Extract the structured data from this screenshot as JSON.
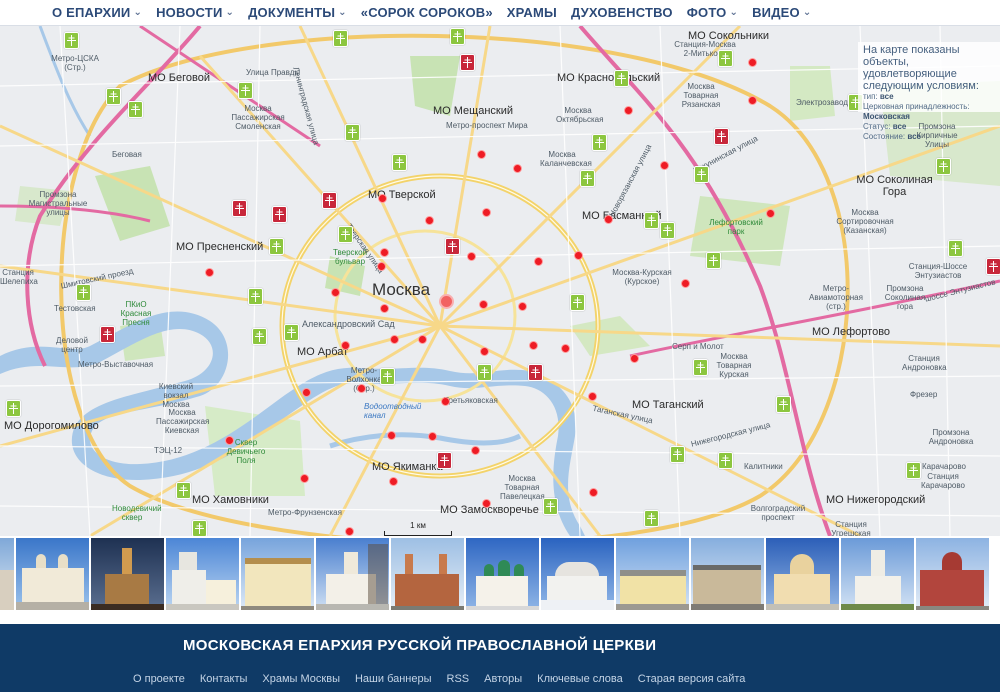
{
  "nav": [
    {
      "label": "О ЕПАРХИИ",
      "dropdown": true
    },
    {
      "label": "НОВОСТИ",
      "dropdown": true
    },
    {
      "label": "ДОКУМЕНТЫ",
      "dropdown": true
    },
    {
      "label": "«СОРОК СОРОКОВ»",
      "dropdown": false
    },
    {
      "label": "ХРАМЫ",
      "dropdown": false
    },
    {
      "label": "ДУХОВЕНСТВО",
      "dropdown": false
    },
    {
      "label": "ФОТО",
      "dropdown": true
    },
    {
      "label": "ВИДЕО",
      "dropdown": true
    }
  ],
  "map": {
    "city_label": "Москва",
    "districts": [
      "МО Беговой",
      "МО Красносельский",
      "МО Сокольники",
      "МО Мещанский",
      "МО Тверской",
      "МО Басманный",
      "МО Соколиная Гора",
      "МО Пресненский",
      "МО Арбат",
      "МО Лефортово",
      "МО Таганский",
      "МО Дорогомилово",
      "МО Якиманка",
      "МО Замоскворечье",
      "МО Хамовники",
      "МО Нижегородский"
    ],
    "places": [
      "Метро-ЦСКА (Стр.)",
      "Москва Пассажирская Смоленская",
      "Беговая",
      "Промзона Магистральные улицы",
      "Станция Шелепиха",
      "Тестовская",
      "ПКиО Красная Пресня",
      "Деловой центр",
      "Метро-Выставочная",
      "Киевский вокзал Москва",
      "Москва Пассажирская Киевская",
      "ТЭЦ-12",
      "Сквер Девичьего Поля",
      "Новодевичий сквер",
      "Метро-Фрунзенская",
      "Метро-Волхонка (Стр.)",
      "Александровский Сад",
      "Тверской бульвар",
      "Метро-проспект Мира",
      "Москва Октябрьская",
      "Москва Каланчевская",
      "Станция-Москва 2-Митьково",
      "Москва Товарная Рязанская",
      "Лефортовский парк",
      "Москва Сортировочная (Казанская)",
      "Москва-Курская (Курское)",
      "Метро-Авиамоторная (стр.)",
      "Промзона Соколиная гора",
      "Серп и Молот",
      "Москва Товарная Курская",
      "Третьяковская",
      "Водоотводный канал",
      "Москва Товарная Павелецкая",
      "Волгоградский проспект",
      "Калитники",
      "Станция Андроновка",
      "Фрезер",
      "Промзона Андроновка",
      "Карачарово",
      "Станция Карачарово",
      "Промзона Кирпичные Улицы",
      "Электрозаводская",
      "Станция-Шоссе Энтузиастов",
      "Станция Угрешская"
    ],
    "streets": [
      "Ленинградская улица",
      "Бакунинская улица",
      "Тверская улица",
      "Шмитовский проезд",
      "Таганская улица",
      "Нижегородская улица",
      "шоссе Энтузиастов",
      "Новорязанская улица",
      "Улица Правды"
    ],
    "info_title": "На карте показаны объекты, удовлетворяющие следующим условиям:",
    "filters": [
      {
        "key": "тип",
        "value": "все"
      },
      {
        "key": "Церковная принадлежность",
        "value": "Московская"
      },
      {
        "key": "Статус",
        "value": "все"
      },
      {
        "key": "Состояние",
        "value": "все"
      }
    ],
    "scale_label": "1 км",
    "marker_colors": {
      "green": "#8cc63f",
      "red": "#c8273a",
      "dot": "#ee1c25"
    }
  },
  "gallery_count": 14,
  "footer": {
    "title": "МОСКОВСКАЯ ЕПАРХИЯ РУССКОЙ ПРАВОСЛАВНОЙ ЦЕРКВИ",
    "links": [
      "О проекте",
      "Контакты",
      "Храмы Москвы",
      "Наши баннеры",
      "RSS",
      "Авторы",
      "Ключевые слова",
      "Старая версия сайта"
    ]
  },
  "colors": {
    "nav_text": "#2c4a78",
    "footer_bg": "#0f3a66"
  }
}
